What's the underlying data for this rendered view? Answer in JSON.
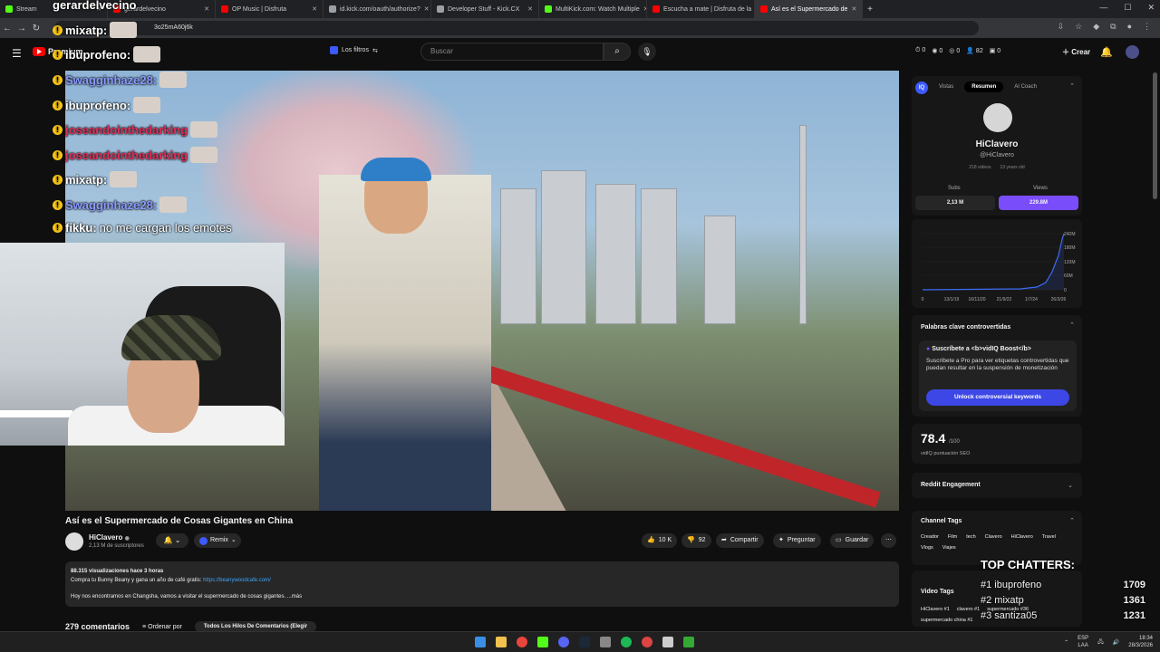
{
  "browser": {
    "tabs": [
      {
        "label": "Stream",
        "color": "#53fc18",
        "active": false
      },
      {
        "label": "gerardelvecino",
        "color": "#ff0000",
        "active": false
      },
      {
        "label": "OP Music | Disfruta",
        "color": "#ff0000",
        "active": false
      },
      {
        "label": "id.kick.com/oauth/authorize?",
        "color": "#9aa0a6",
        "active": false
      },
      {
        "label": "Developer Stuff - Kick.CX",
        "color": "#9aa0a6",
        "active": false
      },
      {
        "label": "MultiKick.com: Watch Multiple",
        "color": "#53fc18",
        "active": false
      },
      {
        "label": "Escucha a mate | Disfruta de la",
        "color": "#ff0000",
        "active": false
      },
      {
        "label": "Así es el Supermercado de",
        "color": "#ff0000",
        "active": true
      }
    ],
    "new_tab": "+",
    "url": "3o25mA60j6k"
  },
  "youtube": {
    "logo_text": "Premium",
    "filters_label": "Los filtros",
    "search_placeholder": "Buscar",
    "header_counts": [
      "0",
      "0",
      "0",
      "82",
      "0"
    ],
    "create_label": "Crear"
  },
  "chat": [
    {
      "user": "gerardelvecino",
      "color": "#ffffff",
      "text": "",
      "top": 0
    },
    {
      "user": "mixatp:",
      "color": "#ffffff",
      "text": "",
      "top": 0
    },
    {
      "user": "ibuprofeno:",
      "color": "#ffffff",
      "text": "",
      "top": 0
    },
    {
      "user": "Swagginhaze28:",
      "color": "#8a9cff",
      "text": "",
      "top": 0
    },
    {
      "user": "ibuprofeno:",
      "color": "#ffffff",
      "text": "",
      "top": 0
    },
    {
      "user": "joseandointhedarking",
      "color": "#e0305a",
      "text": "",
      "top": 0
    },
    {
      "user": "joseandointhedarking",
      "color": "#e0305a",
      "text": "",
      "top": 0
    },
    {
      "user": "mixatp:",
      "color": "#ffffff",
      "text": "",
      "top": 0
    },
    {
      "user": "Swagginhaze28:",
      "color": "#8a9cff",
      "text": "",
      "top": 0
    },
    {
      "user": "fikku:",
      "color": "#ffffff",
      "text": "no me cargan los emotes",
      "top": 0
    }
  ],
  "video": {
    "title": "Así es el Supermercado de Cosas Gigantes en China",
    "channel": "HiClavero",
    "subs": "2,13 M de suscriptores",
    "remix": "Remix",
    "likes": "10 K",
    "dislikes": "92",
    "share": "Compartir",
    "ask": "Preguntar",
    "save": "Guardar",
    "views_line": "88.315 visualizaciones  hace 3 horas",
    "desc_line1": "Compra tu Bunny Beany y gana un año de café gratis: ",
    "desc_link": "https://beanywoodcafe.com/",
    "desc_line2": "Hoy nos encontramos en Changsha, vamos a visitar el supermercado de cosas gigantes. ...más",
    "comments_count": "279 comentarios",
    "sort_label": "Ordenar por",
    "thread_label": "Todos Los Hilos De Comentarios (Elegir"
  },
  "vidiq": {
    "tabs": [
      "Vistas",
      "Resumen",
      "AI Coach"
    ],
    "channel": "HiClavero",
    "handle": "@HiClavero",
    "videos": "218 videos",
    "age": "13 years old",
    "subs_label": "Subs",
    "subs": "2,13 M",
    "views_label": "Views",
    "views": "229.8M",
    "chart_ylabels": [
      "240M",
      "180M",
      "120M",
      "60M",
      "0"
    ],
    "chart_xlabels": [
      "0",
      "13/1/19",
      "16/11/20",
      "21/9/22",
      "1/7/24",
      "26/3/26"
    ],
    "kw_title": "Palabras clave controvertidas",
    "kw_box_title": "Suscríbete a <b>vidIQ Boost</b>",
    "kw_box_text": "Suscríbete a Pro para ver etiquetas controvertidas que puedan resultar en la suspensión de monetización",
    "unlock": "Unlock controversial keywords",
    "seo_score": "78.4",
    "seo_max": "/100",
    "seo_label": "vidIQ puntuación SEO",
    "reddit": "Reddit Engagement",
    "channel_tags_title": "Channel Tags",
    "channel_tags": [
      "Creador",
      "Film",
      "tech",
      "Clavero",
      "HiClavero",
      "Travel",
      "Vlogs",
      "Viajes"
    ],
    "video_tags_title": "Video Tags",
    "video_tags": [
      "HiClavero #1",
      "clavero #1",
      "supermercado #36",
      "supermercado china #1"
    ]
  },
  "top_chatters": {
    "title": "TOP CHATTERS:",
    "rows": [
      {
        "name": "#1 ibuprofeno",
        "count": "1709"
      },
      {
        "name": "#2 mixatp",
        "count": "1361"
      },
      {
        "name": "#3 santiza05",
        "count": "1231"
      }
    ]
  },
  "taskbar": {
    "lang": "ESP",
    "lang2": "LAA",
    "time": "18:34",
    "date": "28/3/2026"
  }
}
